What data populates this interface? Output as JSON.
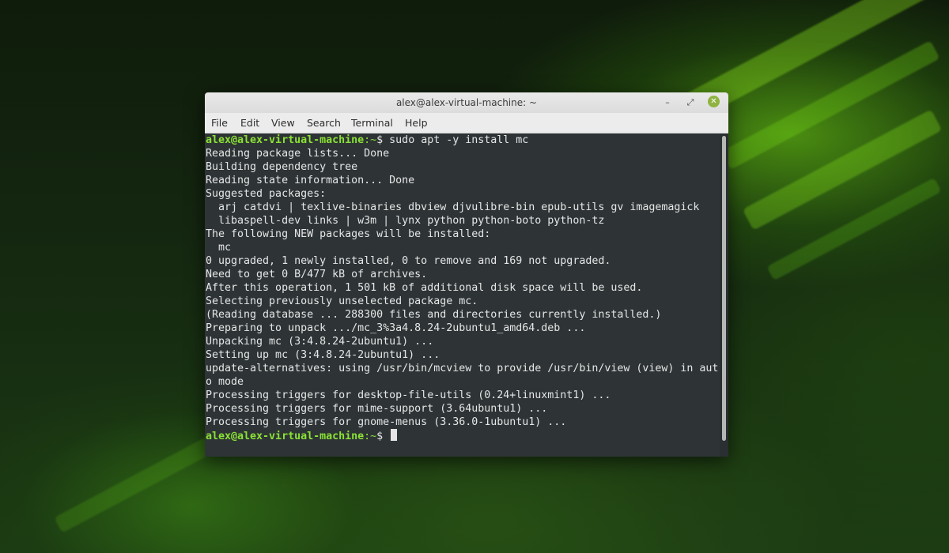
{
  "window": {
    "title": "alex@alex-virtual-machine: ~",
    "accent_close": "#8fb340"
  },
  "menu": {
    "items": [
      "File",
      "Edit",
      "View",
      "Search",
      "Terminal",
      "Help"
    ]
  },
  "terminal": {
    "prompt_user": "alex@alex-virtual-machine",
    "prompt_path": ":~",
    "prompt_symbol": "$ ",
    "command": "sudo apt -y install mc",
    "output": [
      "Reading package lists... Done",
      "Building dependency tree",
      "Reading state information... Done",
      "Suggested packages:",
      "  arj catdvi | texlive-binaries dbview djvulibre-bin epub-utils gv imagemagick",
      "  libaspell-dev links | w3m | lynx python python-boto python-tz",
      "The following NEW packages will be installed:",
      "  mc",
      "0 upgraded, 1 newly installed, 0 to remove and 169 not upgraded.",
      "Need to get 0 B/477 kB of archives.",
      "After this operation, 1 501 kB of additional disk space will be used.",
      "Selecting previously unselected package mc.",
      "(Reading database ... 288300 files and directories currently installed.)",
      "Preparing to unpack .../mc_3%3a4.8.24-2ubuntu1_amd64.deb ...",
      "Unpacking mc (3:4.8.24-2ubuntu1) ...",
      "Setting up mc (3:4.8.24-2ubuntu1) ...",
      "update-alternatives: using /usr/bin/mcview to provide /usr/bin/view (view) in aut",
      "o mode",
      "Processing triggers for desktop-file-utils (0.24+linuxmint1) ...",
      "Processing triggers for mime-support (3.64ubuntu1) ...",
      "Processing triggers for gnome-menus (3.36.0-1ubuntu1) ..."
    ],
    "colors": {
      "background": "#2e3436",
      "foreground": "#e6e6e6",
      "prompt": "#8ae234"
    }
  }
}
